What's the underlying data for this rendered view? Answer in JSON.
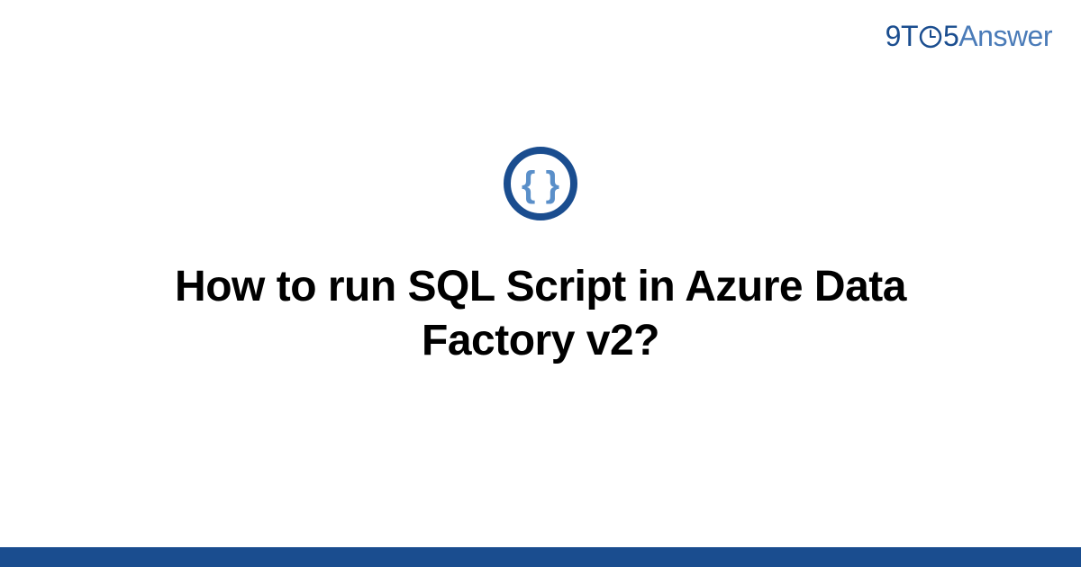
{
  "logo": {
    "part1": "9T",
    "part2": "5",
    "part3": "Answer"
  },
  "icon": {
    "name": "code-braces-icon",
    "brace_left": "{",
    "brace_right": "}"
  },
  "title": "How to run SQL Script in Azure Data Factory v2?",
  "colors": {
    "primary": "#1a4d8f",
    "secondary": "#4a7bb8"
  }
}
